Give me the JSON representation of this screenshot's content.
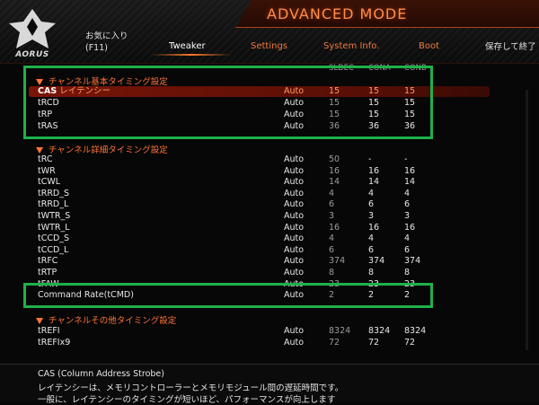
{
  "app": {
    "mode_title": "ADVANCED MODE",
    "logo_text": "AORUS"
  },
  "nav": {
    "favorites_line1": "お気に入り",
    "favorites_line2": "(F11)",
    "tweaker": "Tweaker",
    "settings": "Settings",
    "system_info": "System Info.",
    "boot": "Boot",
    "save_exit": "保存して終了"
  },
  "columns": {
    "c1": "SLDEC",
    "c2": "CONA",
    "c3": "CONB"
  },
  "sections": {
    "basic": "チャンネル基本タイミング設定",
    "advanced": "チャンネル詳細タイミング設定",
    "misc": "チャンネルその他タイミング設定"
  },
  "basic_rows": [
    {
      "name_prefix": "CAS",
      "name": " レイテンシー",
      "mode": "Auto",
      "c1": "15",
      "c2": "15",
      "c3": "15"
    },
    {
      "name": "tRCD",
      "mode": "Auto",
      "c1": "15",
      "c2": "15",
      "c3": "15"
    },
    {
      "name": "tRP",
      "mode": "Auto",
      "c1": "15",
      "c2": "15",
      "c3": "15"
    },
    {
      "name": "tRAS",
      "mode": "Auto",
      "c1": "36",
      "c2": "36",
      "c3": "36"
    }
  ],
  "advanced_rows": [
    {
      "name": "tRC",
      "mode": "Auto",
      "c1": "50",
      "c2": "-",
      "c3": "-"
    },
    {
      "name": "tWR",
      "mode": "Auto",
      "c1": "16",
      "c2": "16",
      "c3": "16"
    },
    {
      "name": "tCWL",
      "mode": "Auto",
      "c1": "14",
      "c2": "14",
      "c3": "14"
    },
    {
      "name": "tRRD_S",
      "mode": "Auto",
      "c1": "4",
      "c2": "4",
      "c3": "4"
    },
    {
      "name": "tRRD_L",
      "mode": "Auto",
      "c1": "6",
      "c2": "6",
      "c3": "6"
    },
    {
      "name": "tWTR_S",
      "mode": "Auto",
      "c1": "3",
      "c2": "3",
      "c3": "3"
    },
    {
      "name": "tWTR_L",
      "mode": "Auto",
      "c1": "16",
      "c2": "16",
      "c3": "16"
    },
    {
      "name": "tCCD_S",
      "mode": "Auto",
      "c1": "4",
      "c2": "4",
      "c3": "4"
    },
    {
      "name": "tCCD_L",
      "mode": "Auto",
      "c1": "6",
      "c2": "6",
      "c3": "6"
    },
    {
      "name": "tRFC",
      "mode": "Auto",
      "c1": "374",
      "c2": "374",
      "c3": "374"
    },
    {
      "name": "tRTP",
      "mode": "Auto",
      "c1": "8",
      "c2": "8",
      "c3": "8"
    },
    {
      "name": "tFAW",
      "mode": "Auto",
      "c1": "23",
      "c2": "23",
      "c3": "23"
    },
    {
      "name": "Command Rate(tCMD)",
      "mode": "Auto",
      "c1": "2",
      "c2": "2",
      "c3": "2"
    }
  ],
  "misc_rows": [
    {
      "name": "tREFI",
      "mode": "Auto",
      "c1": "8324",
      "c2": "8324",
      "c3": "8324"
    },
    {
      "name": "tREFIx9",
      "mode": "Auto",
      "c1": "72",
      "c2": "72",
      "c3": "72"
    }
  ],
  "help": {
    "line1": "CAS (Column Address Strobe)",
    "line2": "レイテンシーは、メモリコントローラーとメモリモジュール間の遅延時間です。",
    "line3": "一般に、レイテンシーのタイミングが短いほど、パフォーマンスが向上します"
  },
  "colors": {
    "accent": "#ff7438",
    "highlight": "#7a1508",
    "callout_box": "#1fb04a"
  }
}
